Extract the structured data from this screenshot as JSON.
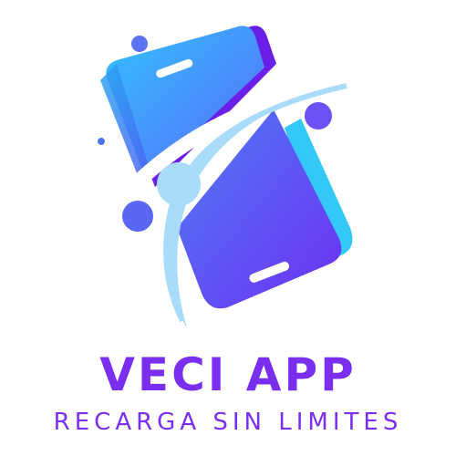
{
  "brand": {
    "name": "VECI APP",
    "tagline": "RECARGA SIN LIMITES"
  },
  "colors": {
    "primary_purple": "#7a2ff0",
    "gradient_start": "#33c2ff",
    "gradient_end": "#6e36f5",
    "arc_light_blue": "#a9dcfb",
    "phone_edge_purple": "#6a1fe8",
    "phone_edge_cyan": "#33c8f5"
  },
  "logo": {
    "icon": "phone-recharge-logo-icon"
  }
}
